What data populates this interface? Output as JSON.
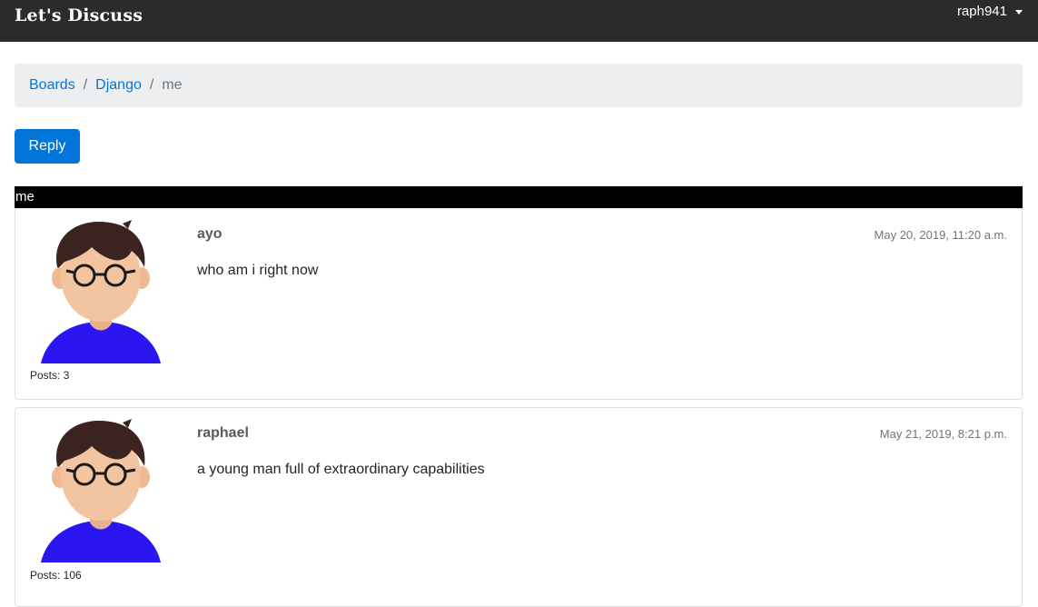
{
  "navbar": {
    "brand": "Let's Discuss",
    "username": "raph941"
  },
  "breadcrumb": {
    "items": [
      "Boards",
      "Django"
    ],
    "separator": "/",
    "current": "me"
  },
  "actions": {
    "reply_label": "Reply"
  },
  "topic": {
    "title": "me"
  },
  "posts": [
    {
      "author": "ayo",
      "date": "May 20, 2019, 11:20 a.m.",
      "message": "who am i right now",
      "post_count": "Posts: 3",
      "avatar": "avatar-icon"
    },
    {
      "author": "raphael",
      "date": "May 21, 2019, 8:21 p.m.",
      "message": "a young man full of extraordinary capabilities",
      "post_count": "Posts: 106",
      "avatar": "avatar-icon"
    }
  ],
  "colors": {
    "navbar_bg": "#292b2c",
    "link": "#0275d8",
    "button": "#0275d8",
    "topic_bar": "#000000",
    "breadcrumb_bg": "#eceeef",
    "avatar_shirt": "#2a16f0"
  }
}
